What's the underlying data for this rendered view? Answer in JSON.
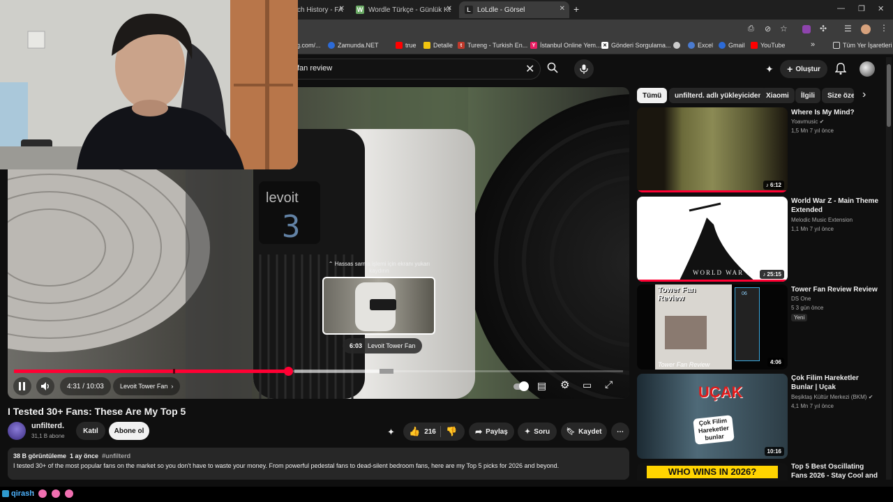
{
  "browser": {
    "tabs": [
      {
        "label": "ch History - FA",
        "fav": "",
        "fav_color": "#444444"
      },
      {
        "label": "Wordle Türkçe - Günlük Kelime",
        "fav": "W",
        "fav_color": "#6aaa64"
      },
      {
        "label": "LoLdle - Görsel",
        "fav": "L",
        "fav_color": "#333333"
      }
    ],
    "new_tab": "+",
    "url_partial": "g.com/...",
    "bookmarks": [
      {
        "label": "Zamunda.NET",
        "icon": "globe-icon",
        "color": "#2c6bd8"
      },
      {
        "label": "true",
        "icon": "youtube-icon",
        "color": "#ff0000"
      },
      {
        "label": "Detalle",
        "icon": "detalle-icon",
        "color": "#f1c40f"
      },
      {
        "label": "Tureng - Turkish En...",
        "icon": "tureng-icon",
        "color": "#c0392b"
      },
      {
        "label": "İstanbul Online Yem...",
        "icon": "yemek-icon",
        "color": "#e91e63"
      },
      {
        "label": "Gönderi Sorgulama...",
        "icon": "ptt-icon",
        "color": "#ffffff"
      },
      {
        "label": "",
        "icon": "github-icon",
        "color": "#cccccc"
      },
      {
        "label": "Excel",
        "icon": "excel-icon",
        "color": "#4a7bd0"
      },
      {
        "label": "Gmail",
        "icon": "gmail-icon",
        "color": "#ea4335"
      },
      {
        "label": "YouTube",
        "icon": "youtube-icon",
        "color": "#ff0000"
      }
    ],
    "more_bookmarks": "»",
    "all_bookmarks": "Tüm Yer İşaretleri"
  },
  "header": {
    "search_value": "fan review",
    "create_label": "Oluştur"
  },
  "player": {
    "scroll_hint": "Hassas sarma işlemi için ekranı yukarı kaydırın",
    "preview_time": "6:03",
    "preview_chapter": "Levoit Tower Fan",
    "time": "4:31 / 10:03",
    "chapter": "Levoit Tower Fan",
    "progress": 0.45,
    "fan_display": "3",
    "fan_brand": "levoit"
  },
  "video": {
    "title": "I Tested 30+ Fans: These Are My Top 5",
    "channel": "unfilterd.",
    "subscribers": "31,1 B abone",
    "join_label": "Katıl",
    "subscribe_label": "Abone ol",
    "likes": "216",
    "share_label": "Paylaş",
    "ask_label": "Soru",
    "save_label": "Kaydet",
    "views": "38 B görüntüleme",
    "age": "1 ay önce",
    "hashtag": "#unfilterd",
    "description": "I tested 30+ of the most popular fans on the market so you don't have to waste your money. From powerful pedestal fans to dead-silent bedroom fans, here are my Top 5 picks for 2026 and beyond."
  },
  "chips": [
    "Tümü",
    "unfilterd. adlı yükleyiciden",
    "Xiaomi",
    "İlgili",
    "Size özel"
  ],
  "related": [
    {
      "title": "Where Is My Mind?",
      "channel": "Yoavmusic",
      "verified": "✔",
      "meta": "1,5 Mn   7 yıl önce",
      "duration": "♪ 6:12",
      "badge": ""
    },
    {
      "title": "World War Z - Main Theme Extended",
      "channel": "Melodic Music Extension",
      "verified": "",
      "meta": "1,1 Mn   7 yıl önce",
      "duration": "♪ 25:15",
      "badge": "",
      "thumb_text": "WORLD WAR Z"
    },
    {
      "title": "Tower Fan Review Review",
      "channel": "DS One",
      "verified": "",
      "meta": "5   3 gün önce",
      "duration": "4:06",
      "badge": "Yeni",
      "thumb_top": "Tower Fan Review",
      "thumb_bottom": "Tower Fan Review",
      "thumb_display": "06"
    },
    {
      "title": "Çok Filim Hareketler Bunlar | Uçak",
      "channel": "Beşiktaş Kültür Merkezi (BKM)",
      "verified": "✔",
      "meta": "4,1 Mn   7 yıl önce",
      "duration": "10:16",
      "badge": "",
      "thumb_text": "UÇAK",
      "thumb_logo": "Çok Filim Hareketler bunlar"
    },
    {
      "title": "Top 5 Best Oscillating Fans 2026 - Stay Cool and",
      "channel": "",
      "verified": "",
      "meta": "",
      "duration": "",
      "badge": "",
      "thumb_text": "WHO WINS IN 2026?"
    }
  ],
  "chat": {
    "user": "qirash",
    "separator": ":"
  },
  "colors": {
    "accent": "#ff0033",
    "background": "#0f0f0f",
    "chip": "#272727"
  }
}
